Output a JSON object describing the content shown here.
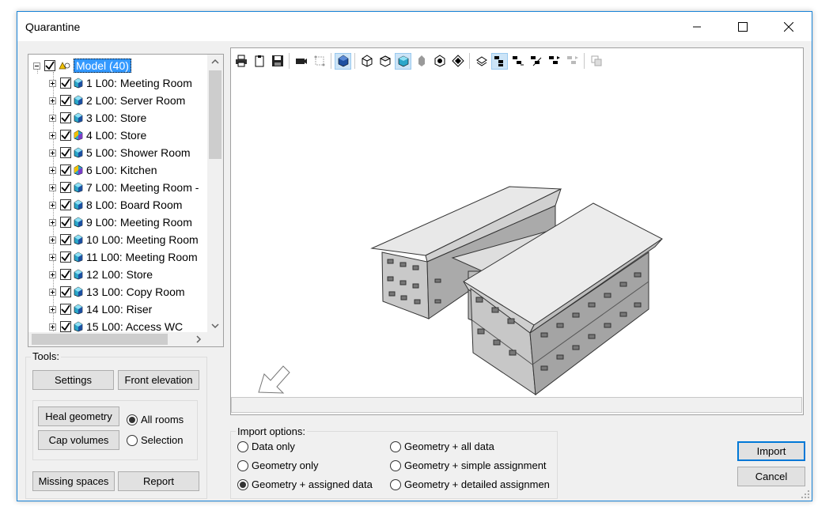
{
  "window": {
    "title": "Quarantine"
  },
  "tree": {
    "root_label": "Model (40)",
    "items": [
      {
        "label": "1 L00: Meeting Room",
        "icon": "room-cube-icon"
      },
      {
        "label": "2 L00: Server Room",
        "icon": "room-cube-icon"
      },
      {
        "label": "3 L00: Store",
        "icon": "room-cube-icon"
      },
      {
        "label": "4 L00: Store",
        "icon": "room-warning-icon"
      },
      {
        "label": "5 L00: Shower Room",
        "icon": "room-cube-icon"
      },
      {
        "label": "6 L00: Kitchen",
        "icon": "room-warning-icon"
      },
      {
        "label": "7 L00: Meeting Room -",
        "icon": "room-cube-icon"
      },
      {
        "label": "8 L00: Board Room",
        "icon": "room-cube-icon"
      },
      {
        "label": "9 L00: Meeting Room",
        "icon": "room-cube-icon"
      },
      {
        "label": "10 L00: Meeting Room",
        "icon": "room-cube-icon"
      },
      {
        "label": "11 L00: Meeting Room",
        "icon": "room-cube-icon"
      },
      {
        "label": "12 L00: Store",
        "icon": "room-cube-icon"
      },
      {
        "label": "13 L00: Copy Room",
        "icon": "room-cube-icon"
      },
      {
        "label": "14 L00: Riser",
        "icon": "room-cube-icon"
      },
      {
        "label": "15 L00: Access WC",
        "icon": "room-cube-icon"
      }
    ]
  },
  "tools": {
    "title": "Tools:",
    "settings": "Settings",
    "front_elevation": "Front elevation",
    "heal_geometry": "Heal geometry",
    "cap_volumes": "Cap volumes",
    "all_rooms": "All rooms",
    "selection": "Selection",
    "missing_spaces": "Missing spaces",
    "report": "Report"
  },
  "import_options": {
    "title": "Import options:",
    "options": [
      "Data only",
      "Geometry only",
      "Geometry + assigned data",
      "Geometry + all data",
      "Geometry + simple assignment",
      "Geometry + detailed assignmen"
    ],
    "selected": "Geometry + assigned data"
  },
  "actions": {
    "import": "Import",
    "cancel": "Cancel"
  },
  "colors": {
    "accent": "#1883d7",
    "selection": "#3399ff",
    "toolbar_active": "#cce4f7"
  }
}
